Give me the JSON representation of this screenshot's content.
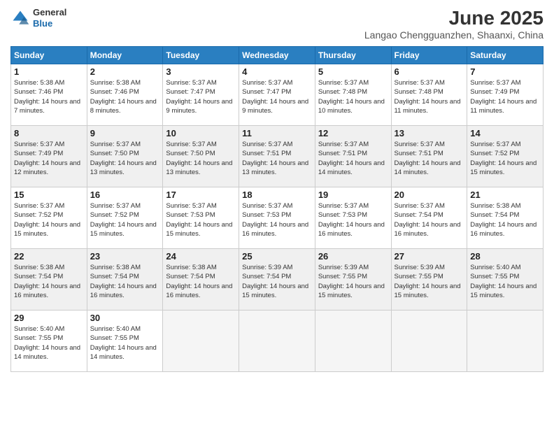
{
  "header": {
    "logo_line1": "General",
    "logo_line2": "Blue",
    "month_title": "June 2025",
    "location": "Langao Chengguanzhen, Shaanxi, China"
  },
  "weekdays": [
    "Sunday",
    "Monday",
    "Tuesday",
    "Wednesday",
    "Thursday",
    "Friday",
    "Saturday"
  ],
  "weeks": [
    [
      {
        "day": "1",
        "sunrise": "5:38 AM",
        "sunset": "7:46 PM",
        "daylight": "14 hours and 7 minutes."
      },
      {
        "day": "2",
        "sunrise": "5:38 AM",
        "sunset": "7:46 PM",
        "daylight": "14 hours and 8 minutes."
      },
      {
        "day": "3",
        "sunrise": "5:37 AM",
        "sunset": "7:47 PM",
        "daylight": "14 hours and 9 minutes."
      },
      {
        "day": "4",
        "sunrise": "5:37 AM",
        "sunset": "7:47 PM",
        "daylight": "14 hours and 9 minutes."
      },
      {
        "day": "5",
        "sunrise": "5:37 AM",
        "sunset": "7:48 PM",
        "daylight": "14 hours and 10 minutes."
      },
      {
        "day": "6",
        "sunrise": "5:37 AM",
        "sunset": "7:48 PM",
        "daylight": "14 hours and 11 minutes."
      },
      {
        "day": "7",
        "sunrise": "5:37 AM",
        "sunset": "7:49 PM",
        "daylight": "14 hours and 11 minutes."
      }
    ],
    [
      {
        "day": "8",
        "sunrise": "5:37 AM",
        "sunset": "7:49 PM",
        "daylight": "14 hours and 12 minutes."
      },
      {
        "day": "9",
        "sunrise": "5:37 AM",
        "sunset": "7:50 PM",
        "daylight": "14 hours and 13 minutes."
      },
      {
        "day": "10",
        "sunrise": "5:37 AM",
        "sunset": "7:50 PM",
        "daylight": "14 hours and 13 minutes."
      },
      {
        "day": "11",
        "sunrise": "5:37 AM",
        "sunset": "7:51 PM",
        "daylight": "14 hours and 13 minutes."
      },
      {
        "day": "12",
        "sunrise": "5:37 AM",
        "sunset": "7:51 PM",
        "daylight": "14 hours and 14 minutes."
      },
      {
        "day": "13",
        "sunrise": "5:37 AM",
        "sunset": "7:51 PM",
        "daylight": "14 hours and 14 minutes."
      },
      {
        "day": "14",
        "sunrise": "5:37 AM",
        "sunset": "7:52 PM",
        "daylight": "14 hours and 15 minutes."
      }
    ],
    [
      {
        "day": "15",
        "sunrise": "5:37 AM",
        "sunset": "7:52 PM",
        "daylight": "14 hours and 15 minutes."
      },
      {
        "day": "16",
        "sunrise": "5:37 AM",
        "sunset": "7:52 PM",
        "daylight": "14 hours and 15 minutes."
      },
      {
        "day": "17",
        "sunrise": "5:37 AM",
        "sunset": "7:53 PM",
        "daylight": "14 hours and 15 minutes."
      },
      {
        "day": "18",
        "sunrise": "5:37 AM",
        "sunset": "7:53 PM",
        "daylight": "14 hours and 16 minutes."
      },
      {
        "day": "19",
        "sunrise": "5:37 AM",
        "sunset": "7:53 PM",
        "daylight": "14 hours and 16 minutes."
      },
      {
        "day": "20",
        "sunrise": "5:37 AM",
        "sunset": "7:54 PM",
        "daylight": "14 hours and 16 minutes."
      },
      {
        "day": "21",
        "sunrise": "5:38 AM",
        "sunset": "7:54 PM",
        "daylight": "14 hours and 16 minutes."
      }
    ],
    [
      {
        "day": "22",
        "sunrise": "5:38 AM",
        "sunset": "7:54 PM",
        "daylight": "14 hours and 16 minutes."
      },
      {
        "day": "23",
        "sunrise": "5:38 AM",
        "sunset": "7:54 PM",
        "daylight": "14 hours and 16 minutes."
      },
      {
        "day": "24",
        "sunrise": "5:38 AM",
        "sunset": "7:54 PM",
        "daylight": "14 hours and 16 minutes."
      },
      {
        "day": "25",
        "sunrise": "5:39 AM",
        "sunset": "7:54 PM",
        "daylight": "14 hours and 15 minutes."
      },
      {
        "day": "26",
        "sunrise": "5:39 AM",
        "sunset": "7:55 PM",
        "daylight": "14 hours and 15 minutes."
      },
      {
        "day": "27",
        "sunrise": "5:39 AM",
        "sunset": "7:55 PM",
        "daylight": "14 hours and 15 minutes."
      },
      {
        "day": "28",
        "sunrise": "5:40 AM",
        "sunset": "7:55 PM",
        "daylight": "14 hours and 15 minutes."
      }
    ],
    [
      {
        "day": "29",
        "sunrise": "5:40 AM",
        "sunset": "7:55 PM",
        "daylight": "14 hours and 14 minutes."
      },
      {
        "day": "30",
        "sunrise": "5:40 AM",
        "sunset": "7:55 PM",
        "daylight": "14 hours and 14 minutes."
      },
      null,
      null,
      null,
      null,
      null
    ]
  ],
  "labels": {
    "sunrise": "Sunrise:",
    "sunset": "Sunset:",
    "daylight": "Daylight:"
  }
}
